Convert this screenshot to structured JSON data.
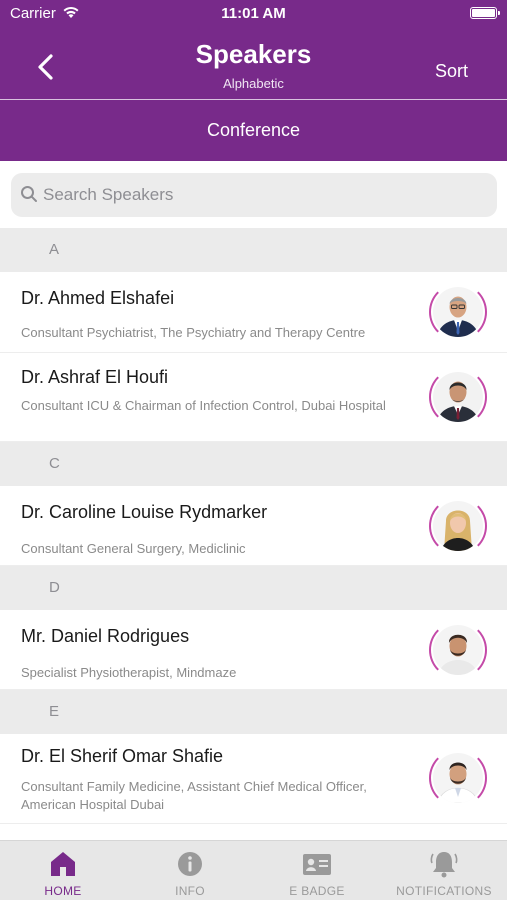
{
  "status_bar": {
    "carrier": "Carrier",
    "time": "11:01 AM"
  },
  "nav": {
    "title": "Speakers",
    "subtitle": "Alphabetic",
    "sort_label": "Sort",
    "conference_tab": "Conference"
  },
  "search": {
    "placeholder": "Search Speakers",
    "value": ""
  },
  "sections": [
    {
      "letter": "A",
      "speakers": [
        {
          "name": "Dr. Ahmed Elshafei",
          "role": "Consultant Psychiatrist, The Psychiatry and Therapy Centre"
        },
        {
          "name": "Dr. Ashraf El Houfi",
          "role": "Consultant ICU & Chairman of Infection Control, Dubai Hospital"
        }
      ]
    },
    {
      "letter": "C",
      "speakers": [
        {
          "name": "Dr. Caroline Louise Rydmarker",
          "role": "Consultant General Surgery, Mediclinic"
        }
      ]
    },
    {
      "letter": "D",
      "speakers": [
        {
          "name": "Mr. Daniel Rodrigues",
          "role": "Specialist Physiotherapist, Mindmaze"
        }
      ]
    },
    {
      "letter": "E",
      "speakers": [
        {
          "name": "Dr. El Sherif Omar Shafie",
          "role": "Consultant Family Medicine, Assistant Chief Medical Officer, American Hospital Dubai"
        }
      ]
    }
  ],
  "tab_bar": [
    {
      "label": "HOME",
      "icon": "home-icon",
      "active": true
    },
    {
      "label": "INFO",
      "icon": "info-icon",
      "active": false
    },
    {
      "label": "E BADGE",
      "icon": "badge-icon",
      "active": false
    },
    {
      "label": "NOTIFICATIONS",
      "icon": "bell-icon",
      "active": false
    }
  ],
  "colors": {
    "primary": "#782a8a",
    "section_bg": "#ebebeb",
    "ring_accent": "#c44aa8"
  }
}
